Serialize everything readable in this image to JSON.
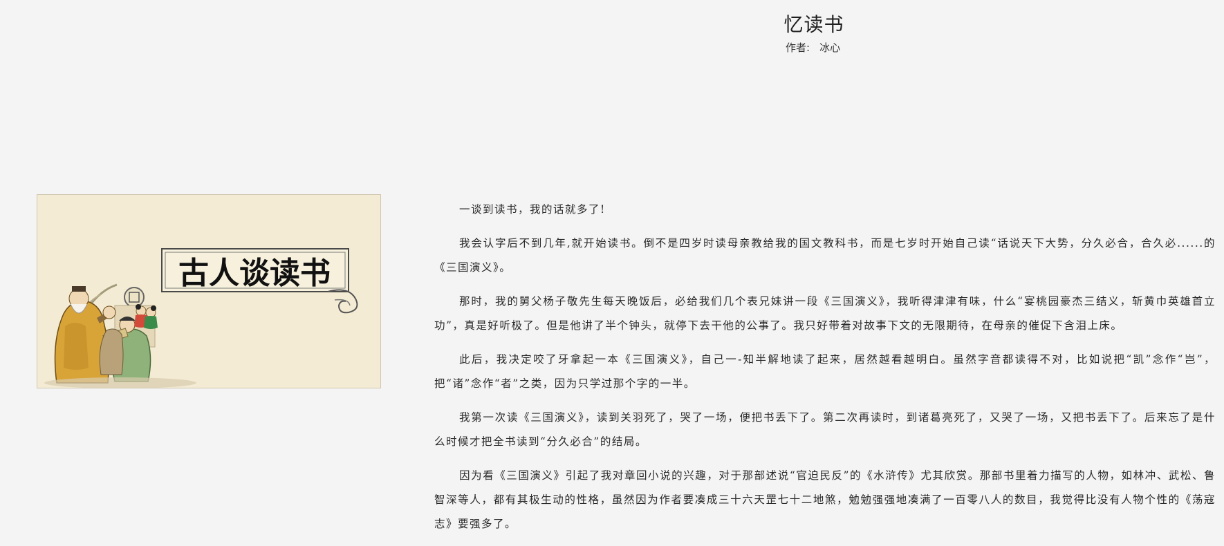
{
  "article": {
    "title": "忆读书",
    "author_label": "作者:",
    "author_name": "冰心",
    "image_caption": "古人谈读书",
    "paragraphs": [
      "一谈到读书，我的话就多了!",
      "我会认字后不到几年,就开始读书。倒不是四岁时读母亲教给我的国文教科书，而是七岁时开始自己读“话说天下大势，分久必合，合久必......的《三国演义》。",
      "那时，我的舅父杨子敬先生每天晚饭后，必给我们几个表兄妹讲一段《三国演义》，我听得津津有味，什么“宴桃园豪杰三结义，斩黄巾英雄首立功”，真是好听极了。但是他讲了半个钟头，就停下去干他的公事了。我只好带着对故事下文的无限期待，在母亲的催促下含泪上床。",
      "此后，我决定咬了牙拿起一本《三国演义》，自己一-知半解地读了起来，居然越看越明白。虽然字音都读得不对，比如说把“凯”念作“岂”，把“诸”念作“者”之类，因为只学过那个字的一半。",
      "我第一次读《三国演义》，读到关羽死了，哭了一场，便把书丢下了。第二次再读时，到诸葛亮死了，又哭了一场，又把书丢下了。后来忘了是什么时候才把全书读到“分久必合”的结局。",
      "因为看《三国演义》引起了我对章回小说的兴趣，对于那部述说“官迫民反”的《水浒传》尤其欣赏。那部书里着力描写的人物，如林冲、武松、鲁智深等人，都有其极生动的性格，虽然因为作者要凑成三十六天罡七十二地煞，勉勉强强地凑满了一百零八人的数目，我觉得比没有人物个性的《荡寇志》要强多了。"
    ]
  }
}
